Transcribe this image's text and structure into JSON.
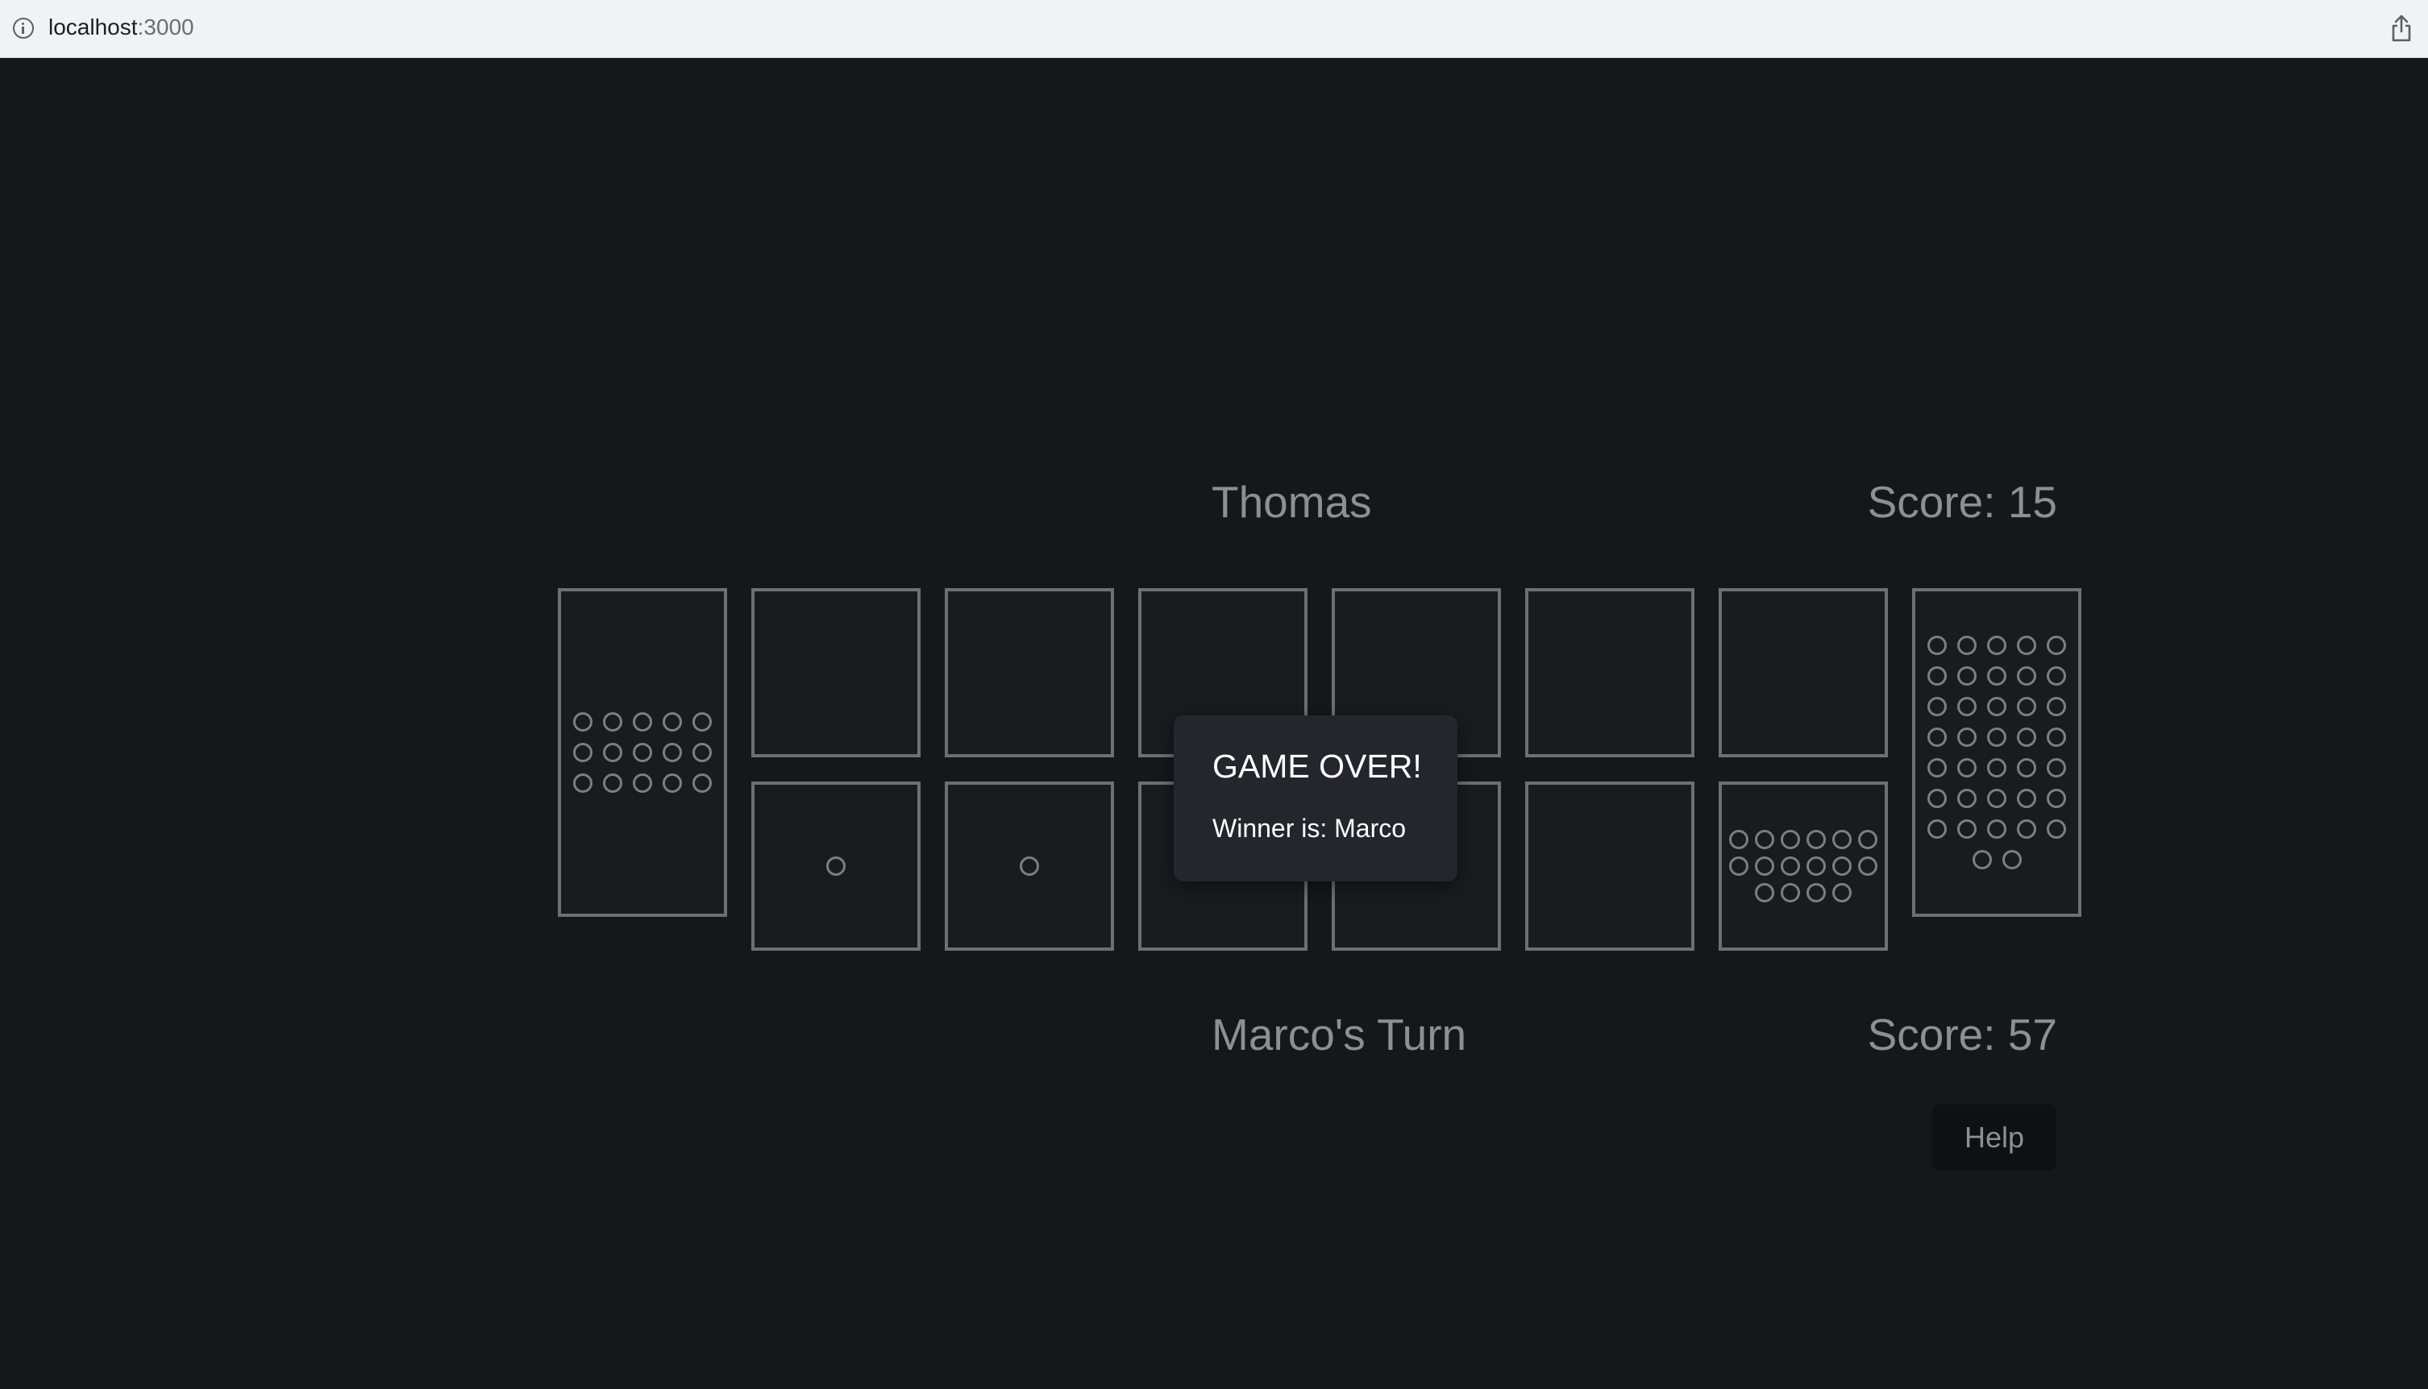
{
  "browser": {
    "url_host": "localhost",
    "url_port": ":3000"
  },
  "top_player": {
    "name": "Thomas",
    "score_label": "Score: 15"
  },
  "bottom_player": {
    "turn_label": "Marco's Turn",
    "score_label": "Score: 57"
  },
  "board": {
    "left_store": 15,
    "right_store": 37,
    "top_pits": [
      0,
      0,
      0,
      0,
      0,
      0
    ],
    "bottom_pits": [
      1,
      1,
      0,
      0,
      0,
      16
    ]
  },
  "modal": {
    "title": "GAME OVER!",
    "message": "Winner is: Marco"
  },
  "help_button": {
    "label": "Help"
  },
  "colors": {
    "background": "#16171b",
    "pit_border": "#6e6f72",
    "text_muted": "#8d8f92",
    "modal_bg": "#23262c"
  }
}
